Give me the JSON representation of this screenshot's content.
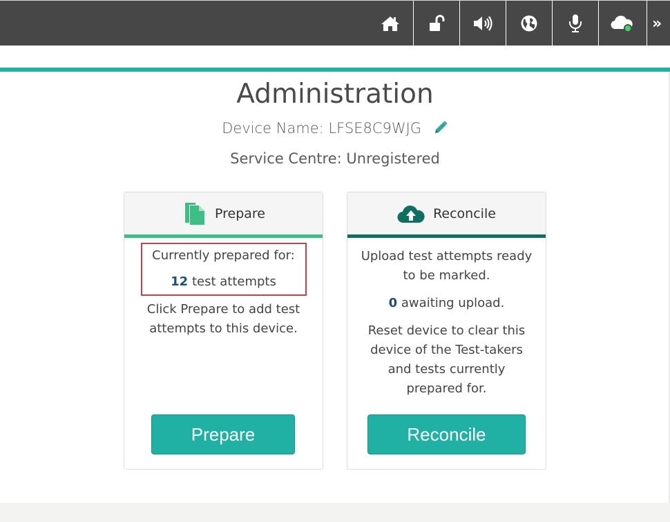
{
  "toolbar": {
    "icons": [
      "home-icon",
      "unlock-icon",
      "volume-icon",
      "globe-icon",
      "microphone-icon",
      "cloud-status-icon"
    ],
    "more_label": "»",
    "bg_color": "#474747"
  },
  "page": {
    "title": "Administration",
    "device_name_label": "Device Name:",
    "device_name_value": "LFSE8C9WJG",
    "service_centre_label": "Service Centre:",
    "service_centre_value": "Unregistered",
    "accent_color": "#26aea3"
  },
  "prepare_card": {
    "title": "Prepare",
    "prepared_for_label": "Currently prepared for:",
    "attempts_count": "12",
    "attempts_label": "test attempts",
    "instructions_line1": "Click Prepare to add test",
    "instructions_line2": "attempts to this device.",
    "button_label": "Prepare"
  },
  "reconcile_card": {
    "title": "Reconcile",
    "upload_line1": "Upload test attempts ready",
    "upload_line2": "to be marked.",
    "awaiting_count": "0",
    "awaiting_label": "awaiting upload.",
    "reset_line1": "Reset device to clear this",
    "reset_line2": "device of the Test-takers",
    "reset_line3": "and tests currently",
    "reset_line4": "prepared for.",
    "button_label": "Reconcile"
  }
}
